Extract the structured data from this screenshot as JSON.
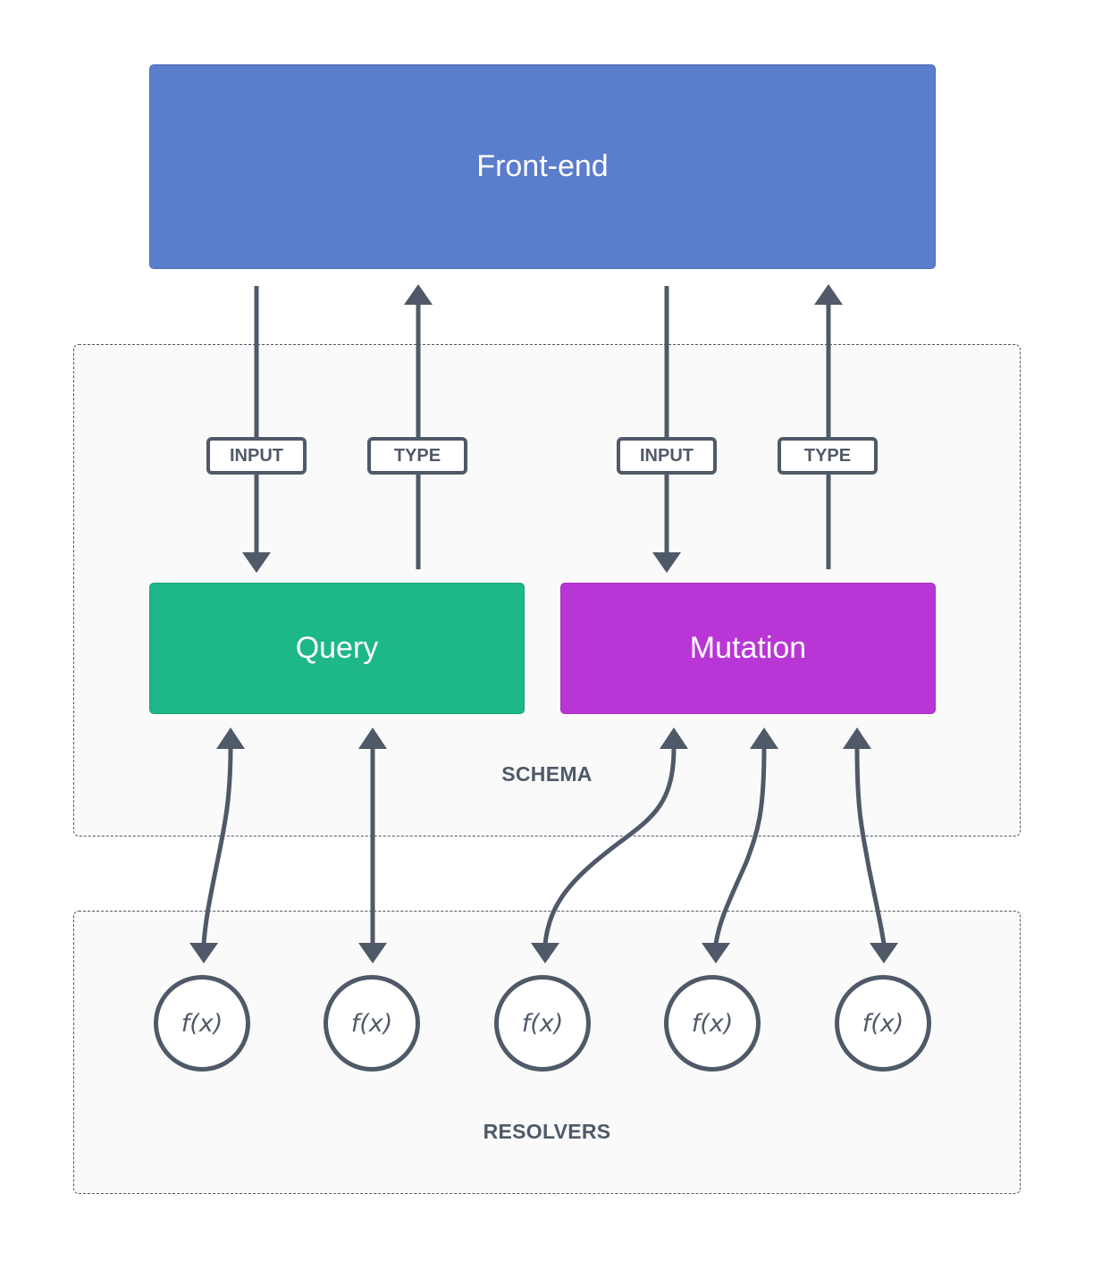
{
  "frontend": {
    "label": "Front-end",
    "color": "#5a7dcc"
  },
  "schema": {
    "label": "SCHEMA",
    "query": {
      "label": "Query",
      "color": "#1db789"
    },
    "mutation": {
      "label": "Mutation",
      "color": "#b936d6"
    },
    "tags": [
      {
        "label": "INPUT",
        "direction": "down",
        "target": "Query"
      },
      {
        "label": "TYPE",
        "direction": "up",
        "target": "Query"
      },
      {
        "label": "INPUT",
        "direction": "down",
        "target": "Mutation"
      },
      {
        "label": "TYPE",
        "direction": "up",
        "target": "Mutation"
      }
    ]
  },
  "resolvers": {
    "label": "RESOLVERS",
    "functions": [
      {
        "label": "f(x)",
        "connects_to": "Query"
      },
      {
        "label": "f(x)",
        "connects_to": "Query"
      },
      {
        "label": "f(x)",
        "connects_to": "Mutation"
      },
      {
        "label": "f(x)",
        "connects_to": "Mutation"
      },
      {
        "label": "f(x)",
        "connects_to": "Mutation"
      }
    ]
  },
  "line_color": "#4f5968"
}
